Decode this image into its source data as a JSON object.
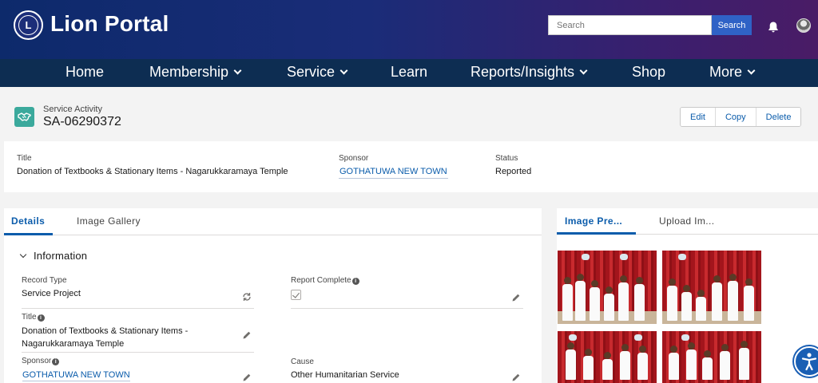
{
  "header": {
    "logo_text": "LIONS",
    "brand": "Lion Portal",
    "search_placeholder": "Search",
    "search_button": "Search",
    "bell_icon": "bell-icon",
    "avatar_icon": "user-avatar"
  },
  "nav": {
    "items": [
      {
        "label": "Home",
        "dropdown": false
      },
      {
        "label": "Membership",
        "dropdown": true
      },
      {
        "label": "Service",
        "dropdown": true
      },
      {
        "label": "Learn",
        "dropdown": false
      },
      {
        "label": "Reports/Insights",
        "dropdown": true
      },
      {
        "label": "Shop",
        "dropdown": false
      },
      {
        "label": "More",
        "dropdown": true
      }
    ]
  },
  "record": {
    "object_type": "Service Activity",
    "name": "SA-06290372",
    "icon": "handshake-icon",
    "actions": [
      "Edit",
      "Copy",
      "Delete"
    ]
  },
  "highlights": {
    "title_label": "Title",
    "title_value": "Donation of Textbooks & Stationary Items - Nagarukkaramaya Temple",
    "sponsor_label": "Sponsor",
    "sponsor_value": "GOTHATUWA NEW TOWN",
    "status_label": "Status",
    "status_value": "Reported"
  },
  "details": {
    "tabs": [
      "Details",
      "Image Gallery"
    ],
    "active_tab": "Details",
    "section_title": "Information",
    "fields": {
      "record_type_label": "Record Type",
      "record_type_value": "Service Project",
      "report_complete_label": "Report Complete",
      "report_complete_checked": true,
      "title_label": "Title",
      "title_value_line1": "Donation of Textbooks & Stationary Items -",
      "title_value_line2": "Nagarukkaramaya Temple",
      "sponsor_label": "Sponsor",
      "sponsor_value": "GOTHATUWA NEW TOWN",
      "cause_label": "Cause",
      "cause_value": "Other Humanitarian Service"
    }
  },
  "gallery": {
    "tabs": [
      "Image Pre...",
      "Upload Im..."
    ],
    "active_tab": "Image Pre...",
    "photos_count": 4
  },
  "colors": {
    "nav_bg": "#0d2d52",
    "accent": "#0b5cab",
    "search_button": "#2f62c6",
    "record_icon": "#3ba99c"
  }
}
